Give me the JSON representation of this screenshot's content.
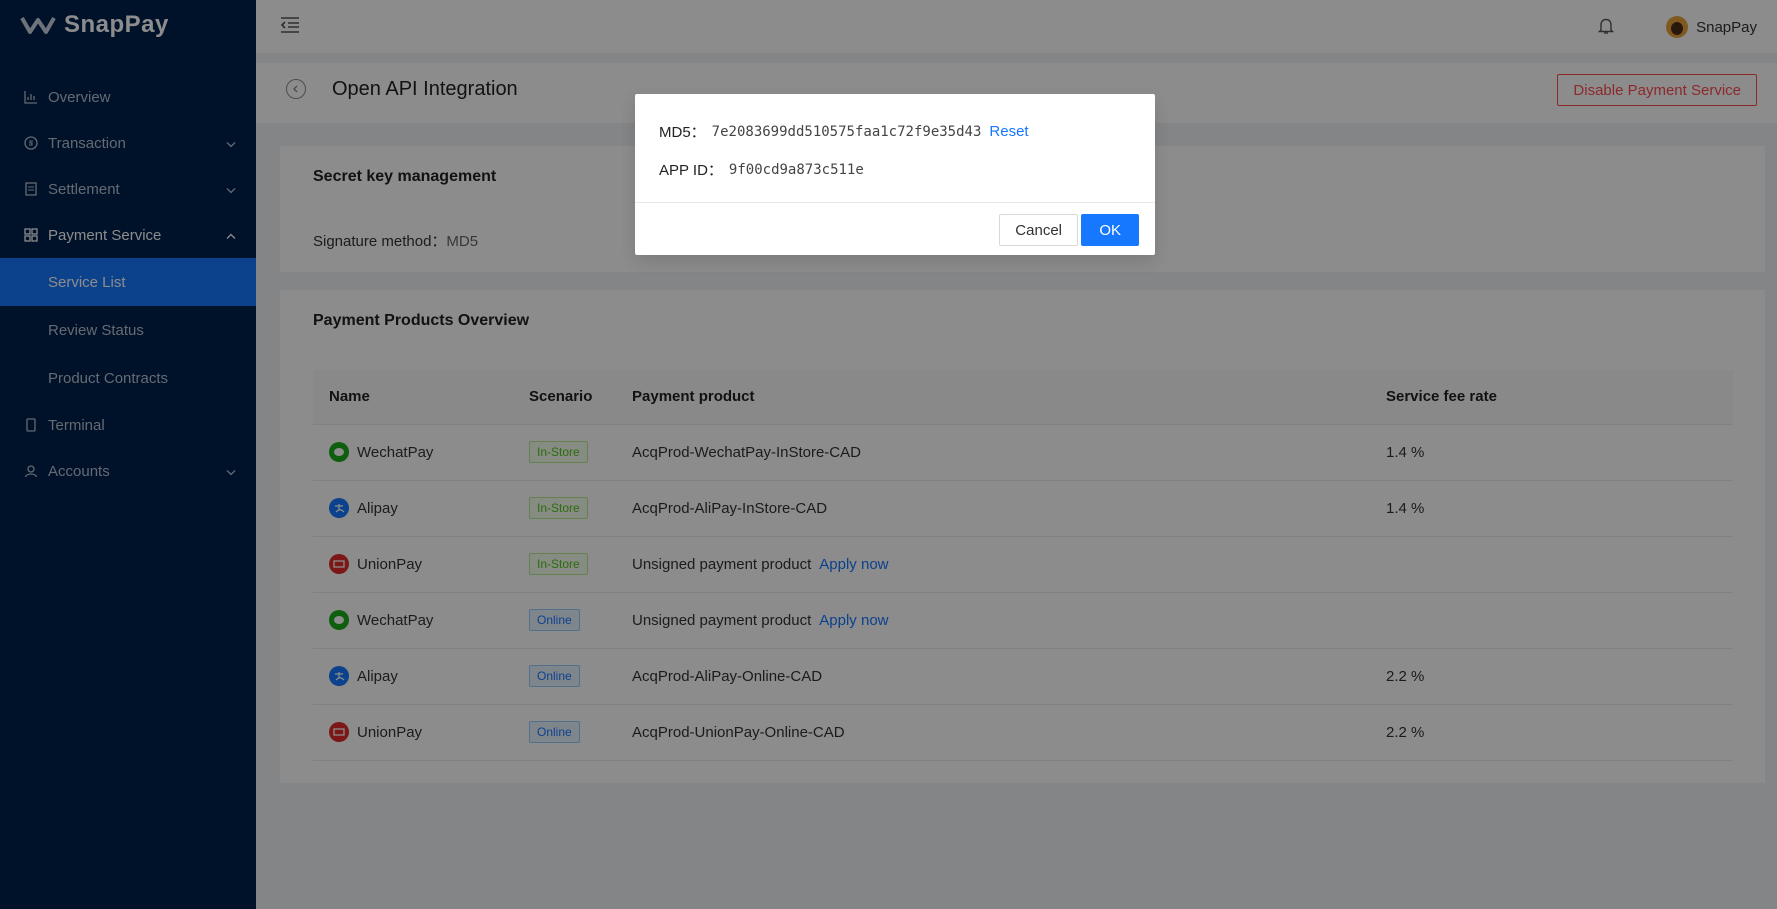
{
  "app": {
    "brand": "SnapPay"
  },
  "sidebar": {
    "items": [
      {
        "label": "Overview",
        "icon": "bar-chart-icon"
      },
      {
        "label": "Transaction",
        "icon": "dollar-circle-icon"
      },
      {
        "label": "Settlement",
        "icon": "receipt-icon"
      },
      {
        "label": "Payment Service",
        "icon": "grid-icon"
      },
      {
        "label": "Terminal",
        "icon": "tablet-icon"
      },
      {
        "label": "Accounts",
        "icon": "user-icon"
      }
    ],
    "sub_items": [
      {
        "label": "Service List"
      },
      {
        "label": "Review Status"
      },
      {
        "label": "Product Contracts"
      }
    ]
  },
  "header": {
    "username": "SnapPay"
  },
  "page": {
    "title": "Open API Integration",
    "disable_button": "Disable Payment Service"
  },
  "secret": {
    "title": "Secret key management",
    "signature_label": "Signature method：",
    "signature_value": "MD5"
  },
  "products": {
    "title": "Payment Products Overview",
    "columns": [
      "Name",
      "Scenario",
      "Payment product",
      "Service fee rate"
    ],
    "rows": [
      {
        "name": "WechatPay",
        "scenario": "In-Store",
        "product": "AcqProd-WechatPay-InStore-CAD",
        "fee": "1.4 %",
        "link": ""
      },
      {
        "name": "Alipay",
        "scenario": "In-Store",
        "product": "AcqProd-AliPay-InStore-CAD",
        "fee": "1.4 %",
        "link": ""
      },
      {
        "name": "UnionPay",
        "scenario": "In-Store",
        "product": "Unsigned payment product",
        "fee": "",
        "link": "Apply now"
      },
      {
        "name": "WechatPay",
        "scenario": "Online",
        "product": "Unsigned payment product",
        "fee": "",
        "link": "Apply now"
      },
      {
        "name": "Alipay",
        "scenario": "Online",
        "product": "AcqProd-AliPay-Online-CAD",
        "fee": "2.2 %",
        "link": ""
      },
      {
        "name": "UnionPay",
        "scenario": "Online",
        "product": "AcqProd-UnionPay-Online-CAD",
        "fee": "2.2 %",
        "link": ""
      }
    ]
  },
  "modal": {
    "md5_label": "MD5：",
    "md5_value": "7e2083699dd510575faa1c72f9e35d43",
    "reset_label": "Reset",
    "appid_label": "APP ID：",
    "appid_value": "9f00cd9a873c511e",
    "cancel_label": "Cancel",
    "ok_label": "OK"
  },
  "colors": {
    "sidebar": "#001f4d",
    "primary": "#1677ff",
    "danger": "#ff4d4f",
    "wechat": "#1aad19",
    "alipay": "#1677ff",
    "unionpay": "#e02a2a"
  }
}
